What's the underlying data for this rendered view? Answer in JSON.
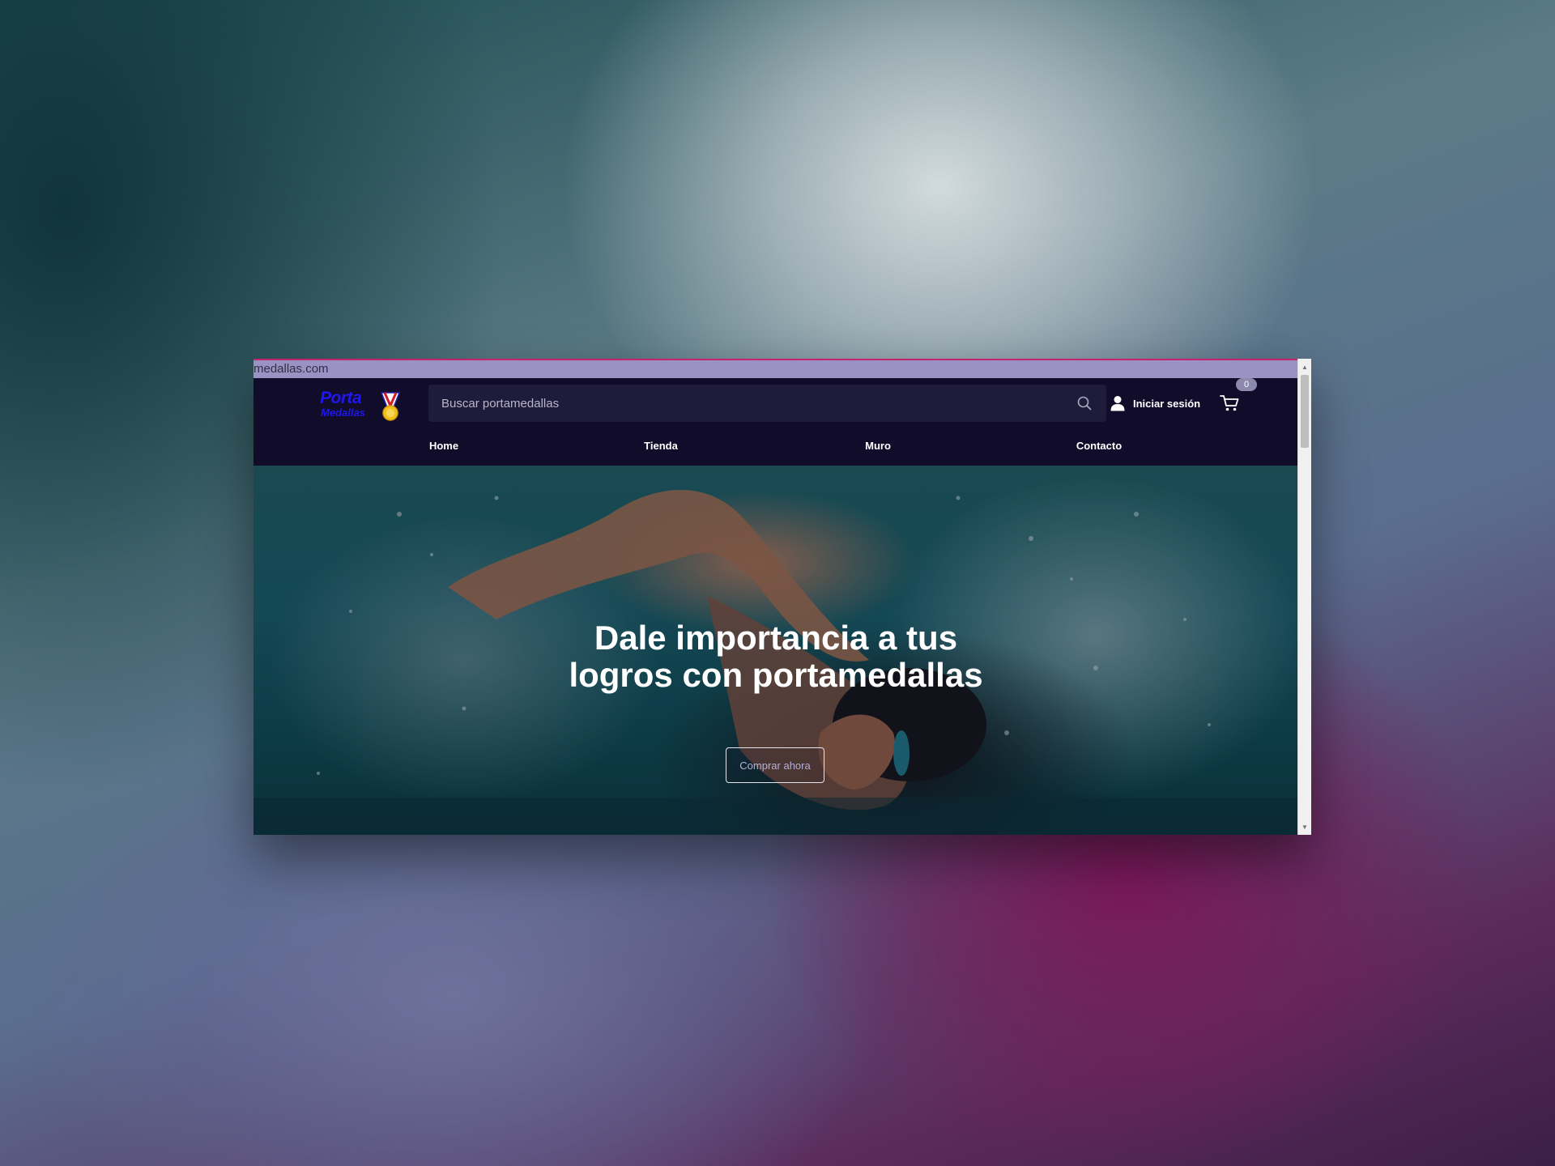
{
  "browser": {
    "url_text": "medallas.com"
  },
  "header": {
    "logo": {
      "line1": "Porta",
      "line2": "Medallas",
      "brand_color": "#1f17ee"
    },
    "search": {
      "placeholder": "Buscar portamedallas"
    },
    "login_label": "Iniciar sesión",
    "cart_count": "0"
  },
  "nav": {
    "items": [
      {
        "label": "Home"
      },
      {
        "label": "Tienda"
      },
      {
        "label": "Muro"
      },
      {
        "label": "Contacto"
      }
    ]
  },
  "hero": {
    "title": "Dale importancia a tus logros con portamedallas",
    "cta_label": "Comprar ahora"
  },
  "colors": {
    "header_bg": "#100c2a",
    "search_bg": "#1f1b3a",
    "url_bar_bg": "#9a92c2",
    "badge_bg": "#8d89ac",
    "cta_text": "#b3b0d6"
  },
  "icons": [
    "medal-icon",
    "search-icon",
    "user-icon",
    "cart-icon"
  ]
}
